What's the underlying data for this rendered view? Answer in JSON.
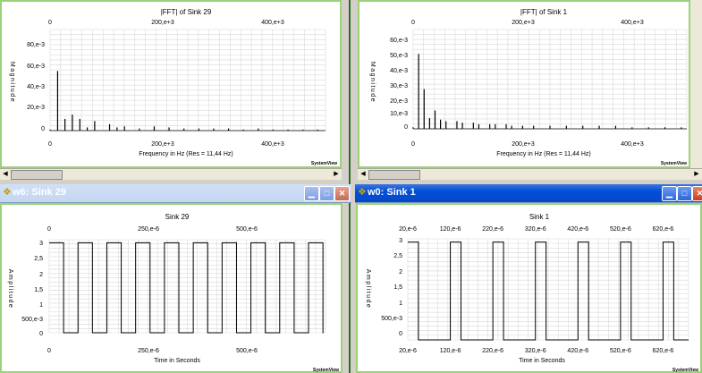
{
  "windows": [
    {
      "id": "w6",
      "title": "w6: Sink 29",
      "active": false,
      "fft": {
        "title": "|FFT| of Sink 29",
        "top_ticks": [
          "0",
          "200,e+3",
          "400,e+3"
        ],
        "bottom_ticks": [
          "0",
          "200,e+3",
          "400,e+3"
        ],
        "xlabel": "Frequency in Hz (Res = 11,44 Hz)",
        "ylabel": "Magnitude",
        "yticks": [
          "80,e-3",
          "60,e-3",
          "40,e-3",
          "20,e-3",
          "0"
        ],
        "brand": "SystemView"
      },
      "time": {
        "title": "Sink 29",
        "top_ticks": [
          "0",
          "250,e-6",
          "500,e-6"
        ],
        "bottom_ticks": [
          "0",
          "250,e-6",
          "500,e-6"
        ],
        "xlabel": "Time in Seconds",
        "ylabel": "Amplitude",
        "yticks": [
          "3",
          "2,5",
          "2",
          "1,5",
          "1",
          "500,e-3",
          "0"
        ],
        "brand": "SystemView"
      }
    },
    {
      "id": "w0",
      "title": "w0: Sink 1",
      "active": true,
      "fft": {
        "title": "|FFT| of Sink 1",
        "top_ticks": [
          "0",
          "200,e+3",
          "400,e+3"
        ],
        "bottom_ticks": [
          "0",
          "200,e+3",
          "400,e+3"
        ],
        "xlabel": "Frequency in Hz (Res = 11,44 Hz)",
        "ylabel": "Magnitude",
        "yticks": [
          "60,e-3",
          "50,e-3",
          "40,e-3",
          "30,e-3",
          "20,e-3",
          "10,e-3",
          "0"
        ],
        "brand": "SystemView"
      },
      "time": {
        "title": "Sink 1",
        "top_ticks": [
          "20,e-6",
          "120,e-6",
          "220,e-6",
          "320,e-6",
          "420,e-6",
          "520,e-6",
          "620,e-6"
        ],
        "bottom_ticks": [
          "20,e-6",
          "120,e-6",
          "220,e-6",
          "320,e-6",
          "420,e-6",
          "520,e-6",
          "620,e-6"
        ],
        "xlabel": "Time in Seconds",
        "ylabel": "Amplitude",
        "yticks": [
          "3",
          "2,5",
          "2",
          "1,5",
          "1",
          "500,e-3",
          "0"
        ],
        "brand": "SystemView"
      }
    }
  ],
  "chart_data": [
    {
      "type": "bar",
      "panel": "fft-w6",
      "title": "|FFT| of Sink 29",
      "xlabel": "Frequency in Hz (Res = 11,44 Hz)",
      "ylabel": "Magnitude",
      "xlim": [
        0,
        500000
      ],
      "ylim": [
        0,
        95
      ],
      "y_unit": "e-3",
      "x": [
        0,
        13700,
        27000,
        40500,
        54000,
        67500,
        81000,
        108000,
        121500,
        135000,
        162000,
        189000,
        216000,
        243000,
        270000,
        297000,
        324000,
        351000,
        378000,
        405000,
        432000,
        459000,
        486000
      ],
      "values": [
        1,
        56,
        11,
        15,
        11,
        3,
        9,
        6,
        3,
        4,
        2,
        4,
        3,
        2,
        2,
        2,
        2,
        1,
        2,
        1,
        1,
        1,
        1
      ]
    },
    {
      "type": "bar",
      "panel": "fft-w0",
      "title": "|FFT| of Sink 1",
      "xlabel": "Frequency in Hz (Res = 11,44 Hz)",
      "ylabel": "Magnitude",
      "xlim": [
        0,
        500000
      ],
      "ylim": [
        0,
        65
      ],
      "y_unit": "e-3",
      "x": [
        0,
        10000,
        20000,
        30000,
        40000,
        50000,
        60000,
        80000,
        90000,
        110000,
        120000,
        140000,
        150000,
        170000,
        180000,
        200000,
        220000,
        250000,
        280000,
        310000,
        340000,
        370000,
        400000,
        430000,
        460000,
        490000
      ],
      "values": [
        1,
        49,
        26,
        7,
        12,
        6,
        5,
        5,
        4,
        4,
        3,
        3,
        3,
        3,
        2,
        2,
        2,
        2,
        2,
        2,
        2,
        2,
        1,
        1,
        1,
        1
      ]
    },
    {
      "type": "line",
      "panel": "time-w6",
      "title": "Sink 29",
      "xlabel": "Time in Seconds",
      "ylabel": "Amplitude",
      "xlim": [
        0,
        700
      ],
      "x_unit": "e-6",
      "ylim": [
        0,
        3.1
      ],
      "period": 73,
      "duty": 0.5,
      "high": 3,
      "low": 0,
      "x_start": 0,
      "x_end": 695
    },
    {
      "type": "line",
      "panel": "time-w0",
      "title": "Sink 1",
      "xlabel": "Time in Seconds",
      "ylabel": "Amplitude",
      "xlim": [
        20,
        680
      ],
      "x_unit": "e-6",
      "ylim": [
        0,
        3.1
      ],
      "period": 100,
      "duty": 0.25,
      "high": 3,
      "low": 0,
      "x_start": 20,
      "x_end": 680
    }
  ]
}
